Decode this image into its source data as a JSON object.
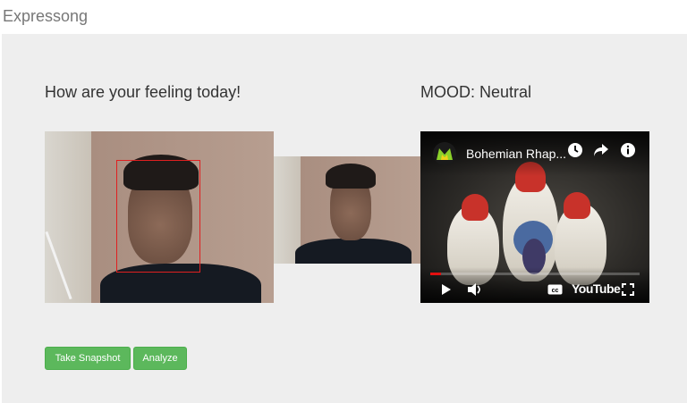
{
  "navbar": {
    "brand": "Expressong"
  },
  "main": {
    "question": "How are your feeling today!",
    "mood": "MOOD: Neutral"
  },
  "video": {
    "title": "Bohemian Rhap...",
    "progress_fraction": 0.05,
    "logo_text": "YouTube",
    "icons": [
      "channel-logo",
      "watch-later-icon",
      "share-icon",
      "info-icon",
      "play-icon",
      "volume-icon",
      "captions-icon",
      "fullscreen-icon"
    ]
  },
  "buttons": {
    "snapshot": "Take Snapshot",
    "analyze": "Analyze"
  },
  "colors": {
    "panel": "#eeeeee",
    "button": "#5cb85c",
    "face_box": "#e02020",
    "progress": "#e31010"
  }
}
